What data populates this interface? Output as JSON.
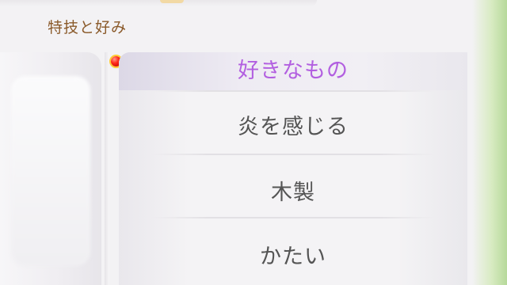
{
  "section": {
    "title": "特技と好み"
  },
  "likes": {
    "header": "好きなもの",
    "items": [
      "炎を感じる",
      "木製",
      "かたい"
    ]
  },
  "colors": {
    "section_title": "#8a5a2a",
    "header_text": "#b25fe0",
    "item_text": "#545454",
    "notification_dot": "#ff2a1a"
  },
  "icons": {
    "notification": "red-dot-icon"
  }
}
